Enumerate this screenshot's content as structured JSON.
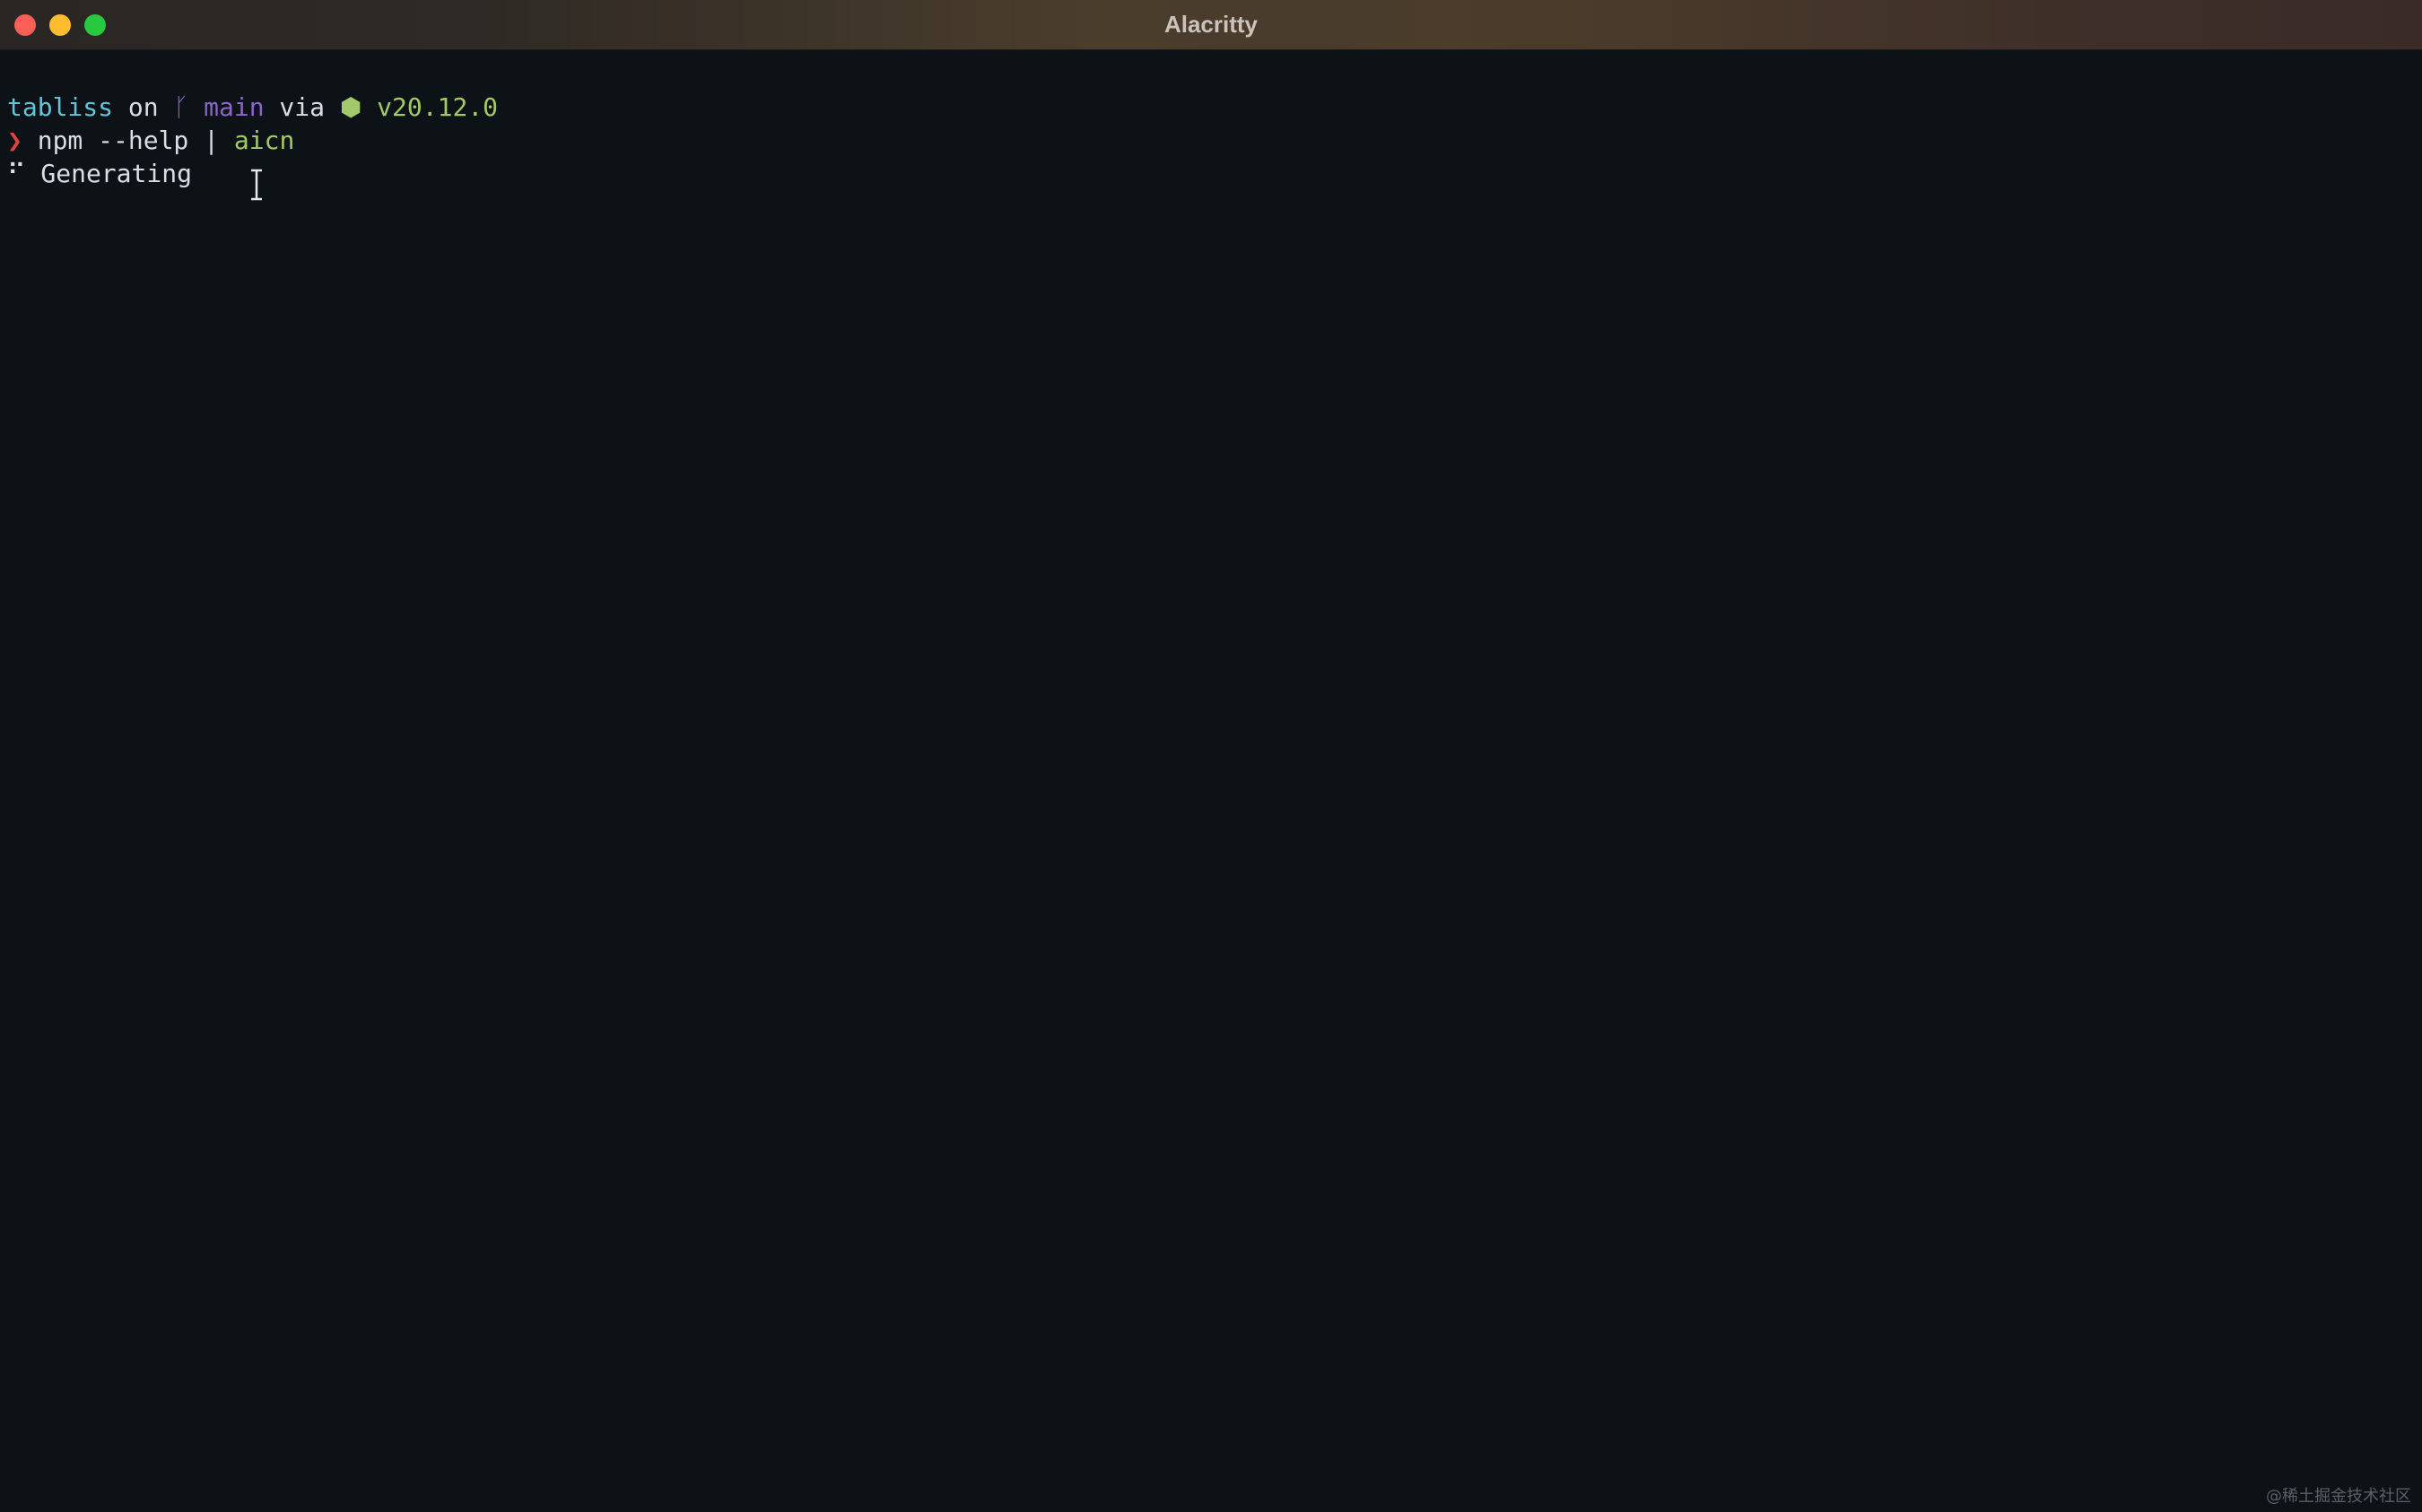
{
  "window": {
    "title": "Alacritty"
  },
  "terminal": {
    "prompt": {
      "directory": "tabliss",
      "on_text": " on ",
      "branch_icon": "git-branch-icon",
      "branch_glyph": "ᚴ",
      "branch": "main",
      "via_text": " via ",
      "node_glyph": "⬢",
      "node_version": "v20.12.0"
    },
    "command_line": {
      "prompt_char": "❯",
      "command": "npm --help | ",
      "pipe_target": "aicn"
    },
    "status_line": {
      "spinner": "⠋",
      "text": "Generating"
    }
  },
  "watermark": "@稀土掘金技术社区",
  "colors": {
    "background": "#0c1216",
    "directory": "#66c2d6",
    "branch": "#8a66c8",
    "node": "#a3c96a",
    "prompt_char": "#e0443f"
  }
}
